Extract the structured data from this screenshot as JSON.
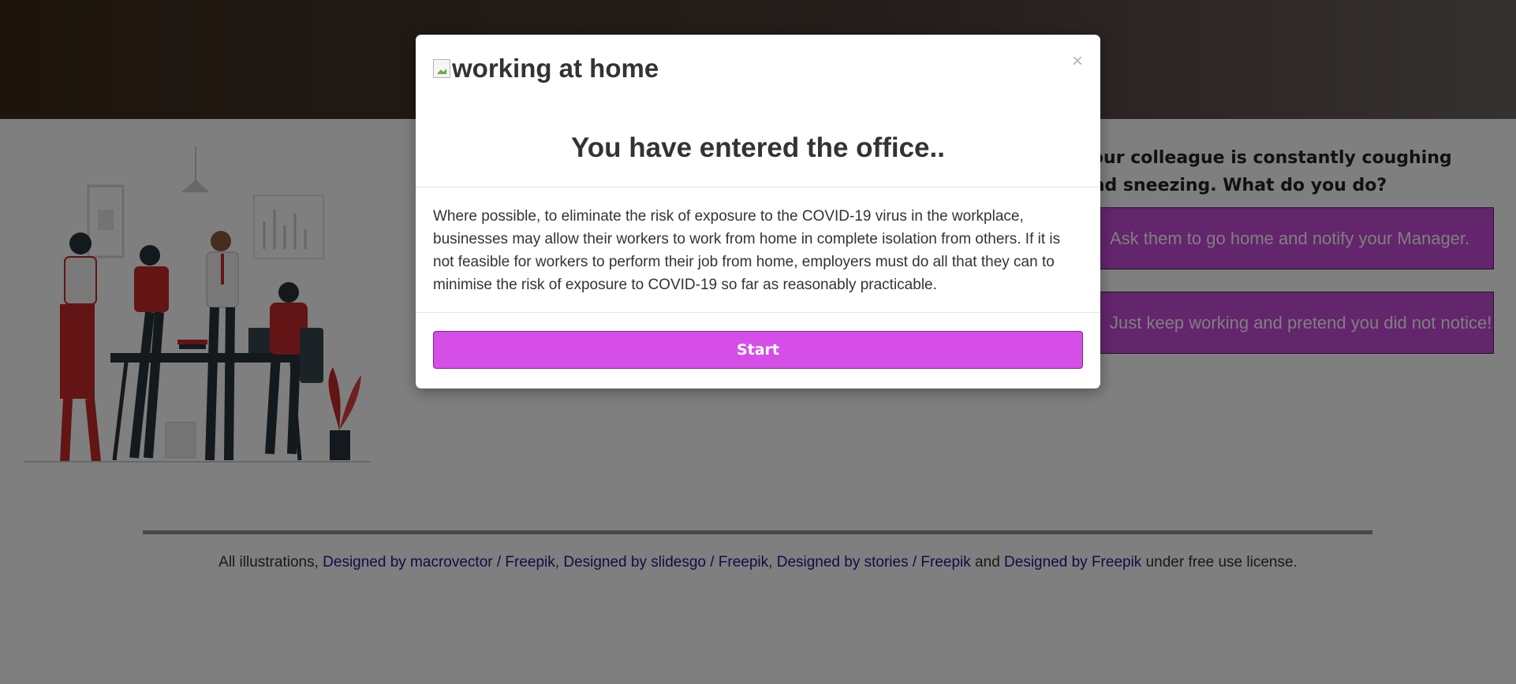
{
  "quiz": {
    "question_line1": "Your colleague is constantly coughing",
    "question_line2": "and sneezing. What do you do?",
    "answers": [
      "Ask them to go home and notify your Manager.",
      "Just keep working and pretend you did not notice!"
    ]
  },
  "footer": {
    "prefix": "All illustrations, ",
    "credits": [
      {
        "text": "Designed by macrovector / Freepik",
        "sep": ", "
      },
      {
        "text": "Designed by slidesgo / Freepik",
        "sep": ", "
      },
      {
        "text": "Designed by stories / Freepik",
        "sep": " and "
      },
      {
        "text": "Designed by Freepik",
        "sep": ""
      }
    ],
    "suffix": " under free use license."
  },
  "modal": {
    "image_alt": "working at home",
    "close_label": "×",
    "title": "You have entered the office..",
    "body": "Where possible, to eliminate the risk of exposure to the COVID-19 virus in the workplace, businesses may allow their workers to work from home in complete isolation from others. If it is not feasible for workers to perform their job from home, employers must do all that they can to minimise the risk of exposure to COVID-19 so far as reasonably practicable.",
    "start_label": "Start"
  },
  "colors": {
    "accent": "#d64ee8",
    "answer_bg": "#c64bd8",
    "link": "#1a1a8f"
  }
}
